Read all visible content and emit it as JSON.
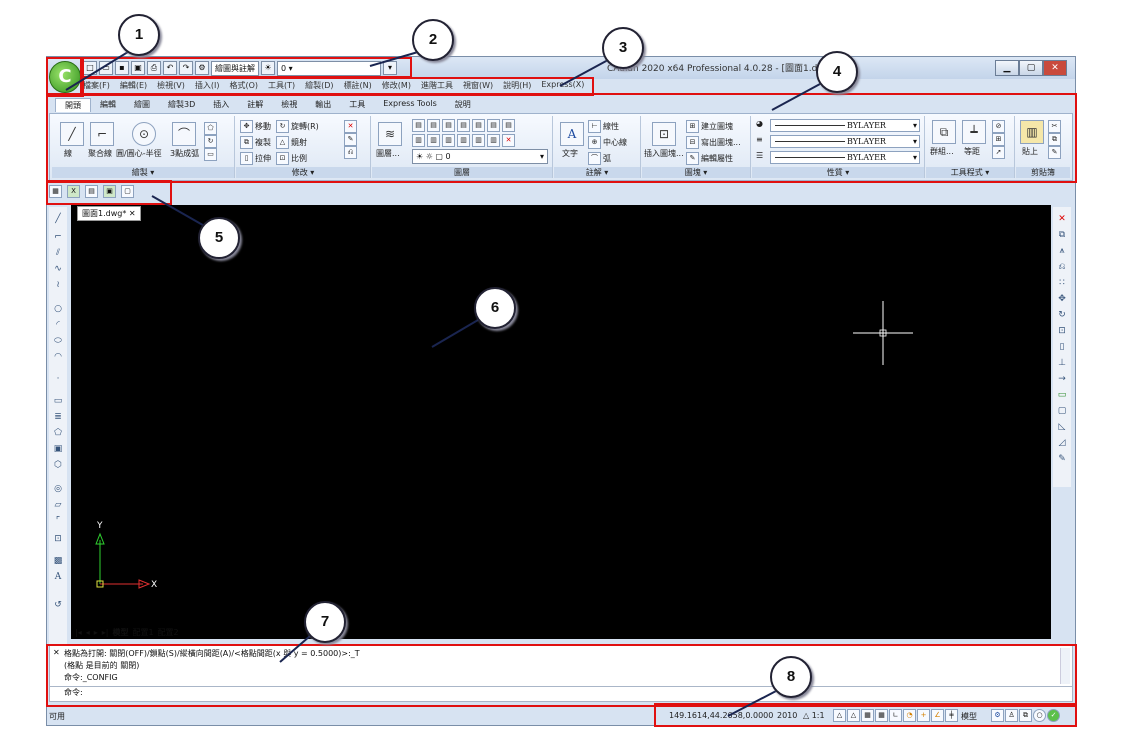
{
  "window": {
    "title": "CAdian 2020 x64 Professional 4.0.28 - [圖面1.dwg*]",
    "min_glyph": "▁",
    "max_glyph": "▢",
    "close_glyph": "✕"
  },
  "quick_access": {
    "workspace": "繪圖與註解",
    "layer": "0"
  },
  "menubar": [
    "檔案(F)",
    "編輯(E)",
    "檢視(V)",
    "插入(I)",
    "格式(O)",
    "工具(T)",
    "繪製(D)",
    "標註(N)",
    "修改(M)",
    "進階工具",
    "視窗(W)",
    "說明(H)",
    "Express(X)"
  ],
  "ribbon_tabs": [
    "開頭",
    "編輯",
    "繪圖",
    "繪製3D",
    "插入",
    "註解",
    "檢視",
    "輸出",
    "工具",
    "Express Tools",
    "說明"
  ],
  "ribbon": {
    "draw": {
      "title": "繪製 ▾",
      "line": "線",
      "polyline": "聚合線",
      "circle": "圓/圓心-半徑",
      "arc": "3點成弧"
    },
    "modify": {
      "title": "修改 ▾",
      "move": "移動",
      "rotate": "旋轉(R)",
      "copy": "複製",
      "mirror": "鏡射",
      "stretch": "拉伸",
      "scale": "比例"
    },
    "layer": {
      "title": "圖層",
      "layer_props": "圖層...",
      "layer_value": "0"
    },
    "annotate": {
      "title": "註解 ▾",
      "text": "文字",
      "linear": "線性",
      "center": "中心線",
      "arc": "弧"
    },
    "block": {
      "title": "圖塊 ▾",
      "insert": "插入圖塊...",
      "create": "建立圖塊",
      "write": "寫出圖塊...",
      "edit_attr": "編輯屬性"
    },
    "properties": {
      "title": "性質 ▾",
      "values": [
        "BYLAYER",
        "BYLAYER",
        "BYLAYER"
      ]
    },
    "tools": {
      "title": "工具程式 ▾",
      "group": "群組...",
      "measure": "等距"
    },
    "clipboard": {
      "title": "剪貼簿",
      "paste": "貼上"
    }
  },
  "document": {
    "tab_label": "圖面1.dwg*",
    "ucs_y": "Y",
    "ucs_x": "X"
  },
  "layout_tabs": [
    "模型",
    "配置1",
    "配置2"
  ],
  "command": {
    "line1": "格點為打開: 關閉(OFF)/鎖點(S)/縱橫向間距(A)/<格點間距(x 與 y = 0.5000)>:_T",
    "line2": "(格點 是目前的 關閉)",
    "line3": "命令:_CONFIG",
    "prompt": "命令:"
  },
  "status": {
    "left_text": "可用",
    "coords": "149.1614,44.2658,0.0000",
    "version": "2010",
    "scale": "1:1",
    "model": "模型"
  },
  "callouts": [
    "1",
    "2",
    "3",
    "4",
    "5",
    "6",
    "7",
    "8"
  ],
  "colors": {
    "annotation_red": "#e01010",
    "canvas": "#000000",
    "ribbon_bg": "#dde7f4"
  }
}
